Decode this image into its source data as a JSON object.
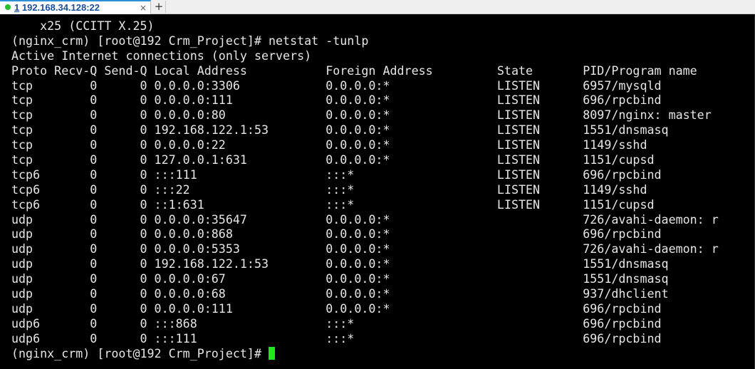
{
  "tab": {
    "number": "1",
    "title": "192.168.34.128:22",
    "close_glyph": "×",
    "add_glyph": "+",
    "status_icon": "connected-dot-icon",
    "status_color": "#22c02a"
  },
  "terminal": {
    "lines": [
      "    x25 (CCITT X.25)",
      "(nginx_crm) [root@192 Crm_Project]# netstat -tunlp",
      "Active Internet connections (only servers)",
      "Proto Recv-Q Send-Q Local Address           Foreign Address         State       PID/Program name",
      "tcp        0      0 0.0.0.0:3306            0.0.0.0:*               LISTEN      6957/mysqld",
      "tcp        0      0 0.0.0.0:111             0.0.0.0:*               LISTEN      696/rpcbind",
      "tcp        0      0 0.0.0.0:80              0.0.0.0:*               LISTEN      8097/nginx: master",
      "tcp        0      0 192.168.122.1:53        0.0.0.0:*               LISTEN      1551/dnsmasq",
      "tcp        0      0 0.0.0.0:22              0.0.0.0:*               LISTEN      1149/sshd",
      "tcp        0      0 127.0.0.1:631           0.0.0.0:*               LISTEN      1151/cupsd",
      "tcp6       0      0 :::111                  :::*                    LISTEN      696/rpcbind",
      "tcp6       0      0 :::22                   :::*                    LISTEN      1149/sshd",
      "tcp6       0      0 ::1:631                 :::*                    LISTEN      1151/cupsd",
      "udp        0      0 0.0.0.0:35647           0.0.0.0:*                           726/avahi-daemon: r",
      "udp        0      0 0.0.0.0:868             0.0.0.0:*                           696/rpcbind",
      "udp        0      0 0.0.0.0:5353            0.0.0.0:*                           726/avahi-daemon: r",
      "udp        0      0 192.168.122.1:53        0.0.0.0:*                           1551/dnsmasq",
      "udp        0      0 0.0.0.0:67              0.0.0.0:*                           1551/dnsmasq",
      "udp        0      0 0.0.0.0:68              0.0.0.0:*                           937/dhclient",
      "udp        0      0 0.0.0.0:111             0.0.0.0:*                           696/rpcbind",
      "udp6       0      0 :::868                  :::*                                696/rpcbind",
      "udp6       0      0 :::111                  :::*                                696/rpcbind"
    ],
    "prompt": "(nginx_crm) [root@192 Crm_Project]# ",
    "text_color": "#e6e6e6",
    "background_color": "#000000",
    "cursor_color": "#1ee81e"
  }
}
